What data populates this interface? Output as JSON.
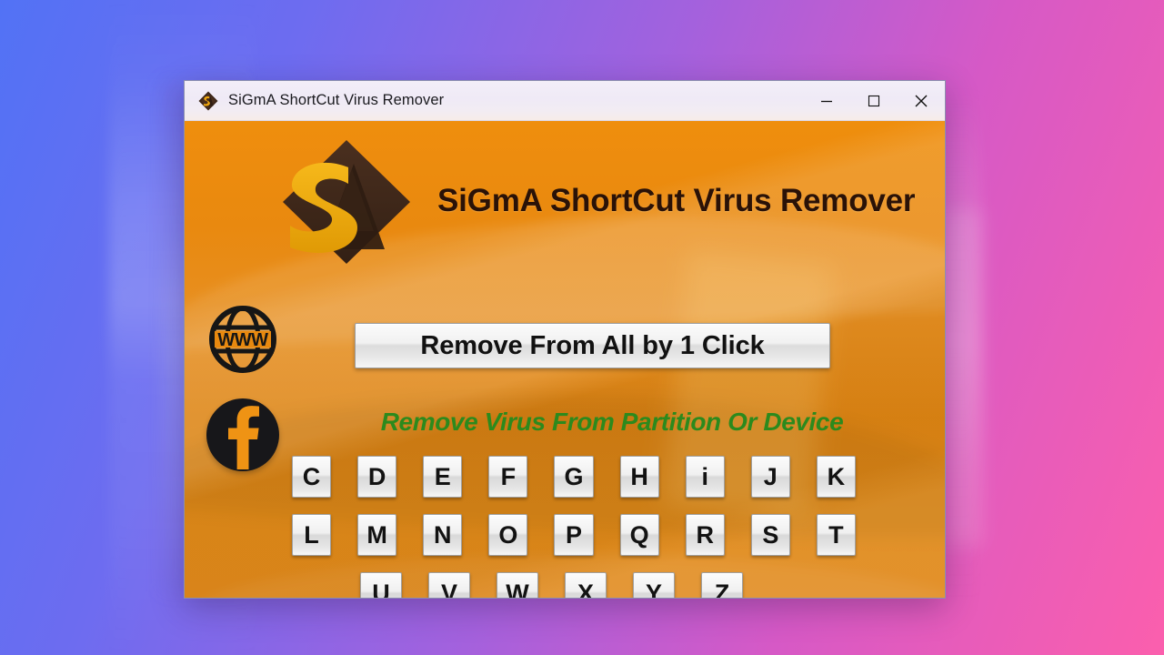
{
  "window": {
    "title": "SiGmA ShortCut Virus Remover",
    "icon": "app-logo-icon",
    "controls": {
      "minimize": "minimize-icon",
      "maximize": "maximize-icon",
      "close": "close-icon"
    }
  },
  "header": {
    "logo_icon": "sigma-diamond-logo",
    "app_title": "SiGmA ShortCut Virus Remover"
  },
  "social": [
    {
      "name": "website-link",
      "icon": "globe-www-icon",
      "label": "WWW"
    },
    {
      "name": "facebook-link",
      "icon": "facebook-icon",
      "label": "f"
    }
  ],
  "actions": {
    "remove_all_label": "Remove From All by 1 Click"
  },
  "subtitle": "Remove Virus From Partition Or Device",
  "drives": {
    "rows": [
      [
        "C",
        "D",
        "E",
        "F",
        "G",
        "H",
        "i",
        "J",
        "K"
      ],
      [
        "L",
        "M",
        "N",
        "O",
        "P",
        "Q",
        "R",
        "S",
        "T"
      ],
      [
        "U",
        "V",
        "W",
        "X",
        "Y",
        "Z"
      ]
    ]
  },
  "colors": {
    "desktop_gradient_start": "#5272f5",
    "desktop_gradient_end": "#fb5fad",
    "window_body_orange": "#e8890f",
    "titlebar": "#f1ecf6",
    "subtitle_green": "#2c8a1d",
    "heading_dark": "#2a1207",
    "logo_gold": "#f0a80f",
    "logo_dark": "#3a2418"
  }
}
